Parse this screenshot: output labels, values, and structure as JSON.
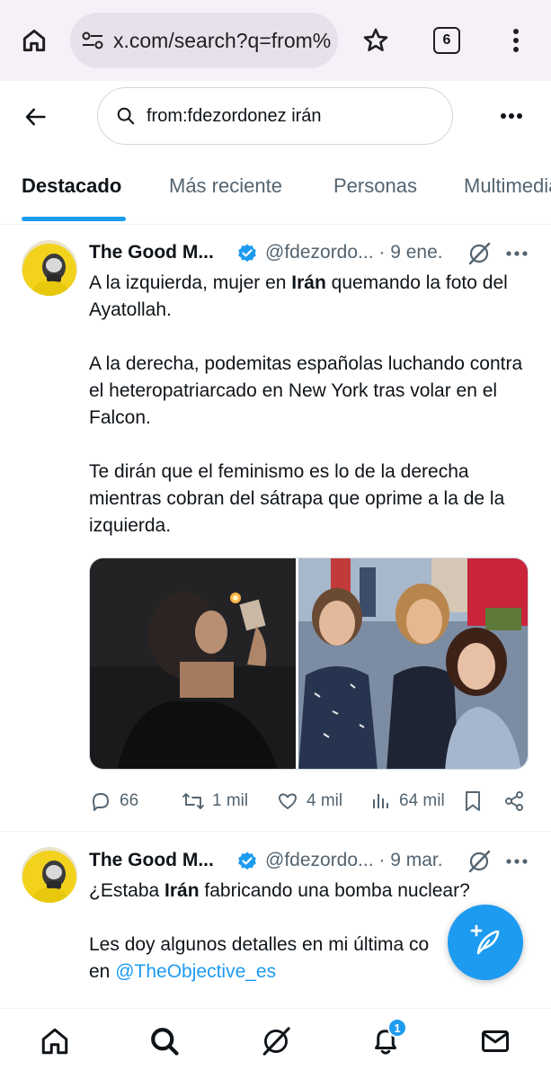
{
  "browser": {
    "url": "x.com/search?q=from%",
    "tab_count": "6"
  },
  "search": {
    "query": "from:fdezordonez irán"
  },
  "tabs": [
    {
      "label": "Destacado"
    },
    {
      "label": "Más reciente"
    },
    {
      "label": "Personas"
    },
    {
      "label": "Multimedia"
    }
  ],
  "tweets": [
    {
      "name": "The Good M...",
      "handle": "@fdezordo...",
      "date": "· 9 ene.",
      "text": {
        "p1_pre": "A la izquierda, mujer en ",
        "p1_bold": "Irán",
        "p1_post": " quemando la foto del Ayatollah.",
        "p2": "A la derecha, podemitas españolas luchando contra el heteropatriarcado en New York tras volar en el Falcon.",
        "p3": "Te dirán que el feminismo es lo de la derecha mientras cobran del sátrapa que oprime a la de la izquierda."
      },
      "stats": {
        "replies": "66",
        "reposts": "1 mil",
        "likes": "4 mil",
        "views": "64 mil"
      }
    },
    {
      "name": "The Good M...",
      "handle": "@fdezordo...",
      "date": "· 9 mar.",
      "text": {
        "p1_pre": "¿Estaba ",
        "p1_bold": "Irán",
        "p1_post": " fabricando una bomba nuclear?",
        "p2": "Les doy algunos detalles en mi última co",
        "p3_pre": "en ",
        "mention": "@TheObjective_es"
      }
    }
  ],
  "notifications_badge": "1",
  "colors": {
    "accent": "#1d9bf0",
    "text": "#0f1419",
    "secondary": "#536471",
    "chrome_bg": "#f6f1f8"
  }
}
